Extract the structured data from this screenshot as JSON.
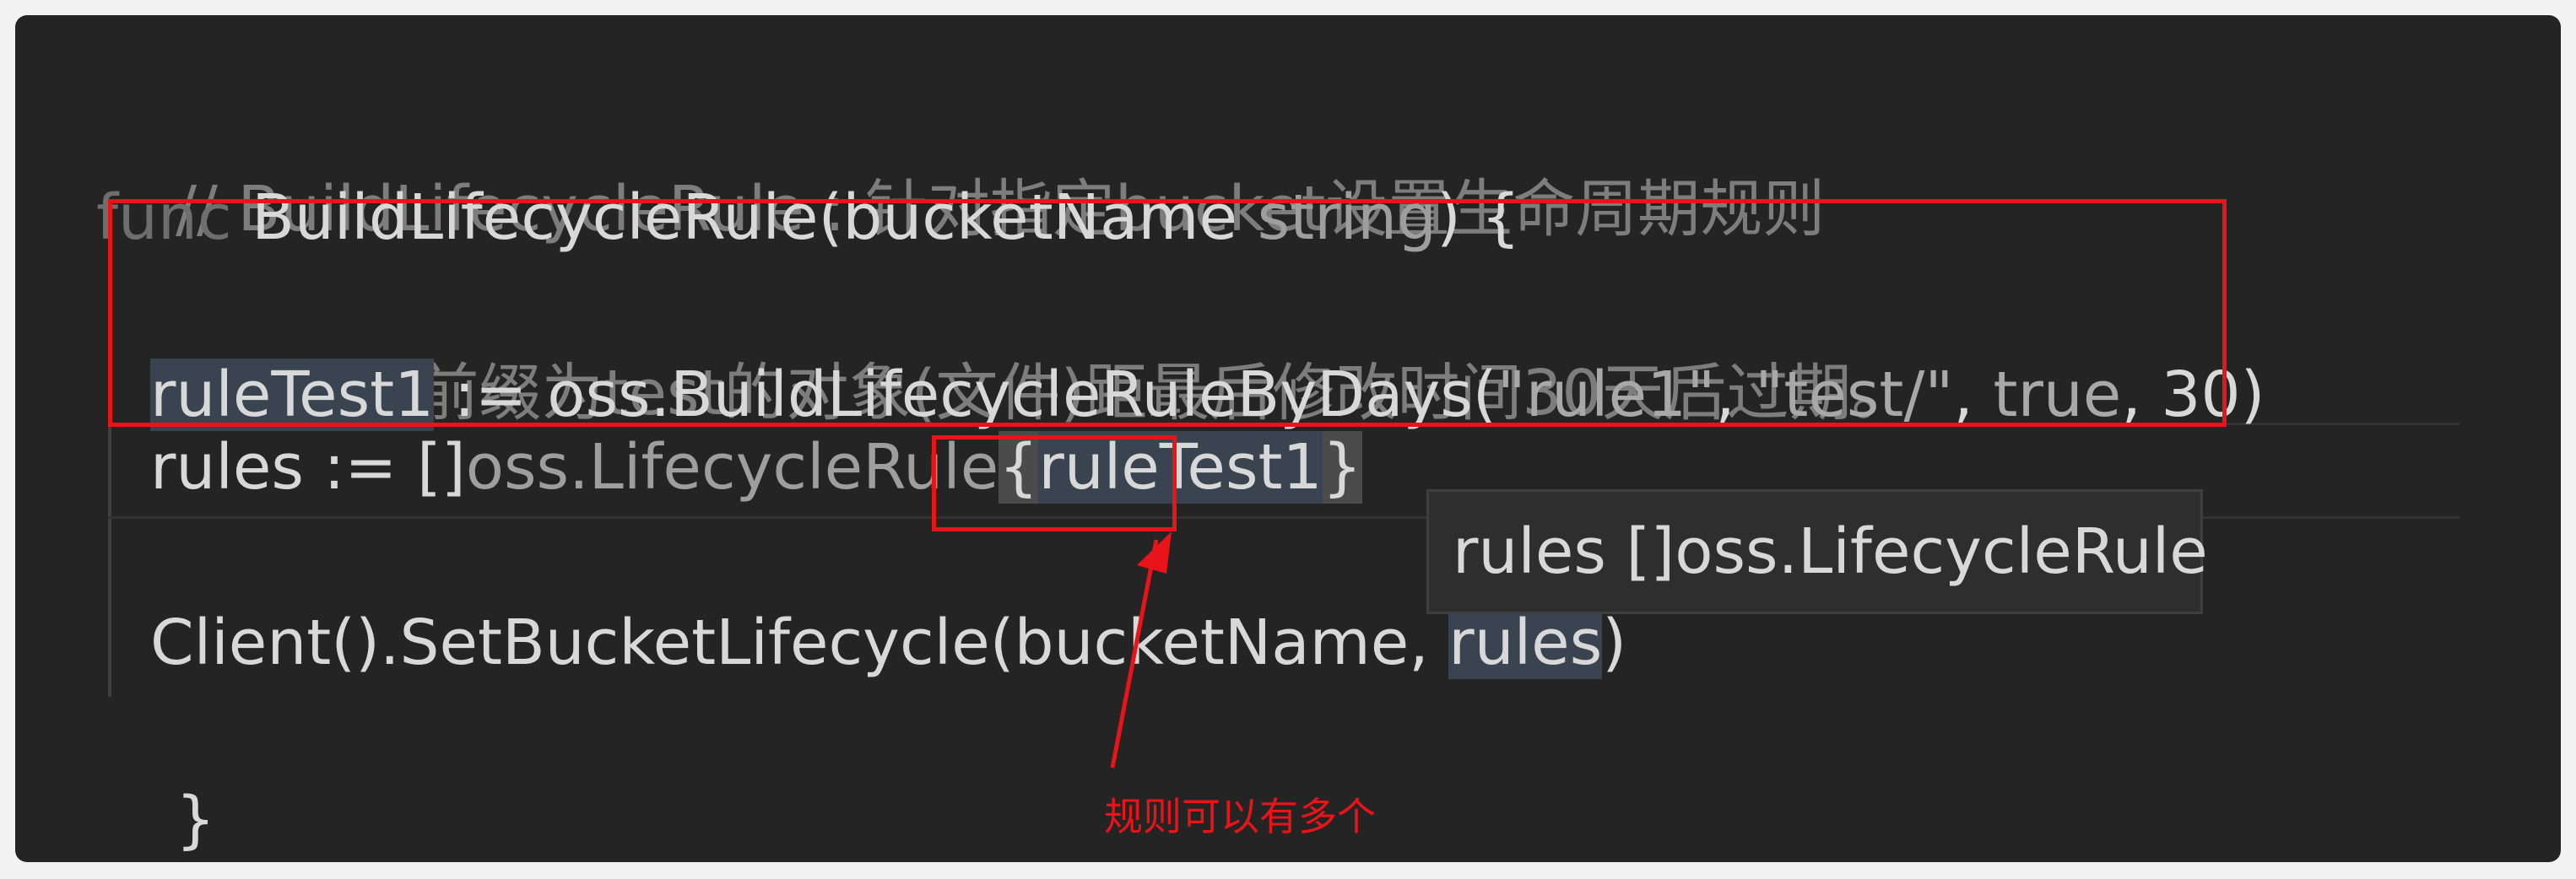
{
  "code": {
    "line1": {
      "comment": "// BuildLifecycleRule : 针对指定bucket设置生命周期规则"
    },
    "line2": {
      "kw": "func",
      "name": " BuildLifecycleRule(",
      "param": "bucketName",
      "type": " string",
      "rest": ") {"
    },
    "line3": {
      "comment": "// 表示前缀为test的对象(文件)距最后修改时间30天后过期。"
    },
    "line4": {
      "var": "ruleTest1",
      "op": " := oss.BuildLifecycleRuleByDays(",
      "s1": "\"rule1\"",
      "c1": ", ",
      "s2": "\"test/\"",
      "c2": ", ",
      "b": "true",
      "c3": ", ",
      "n": "30",
      "end": ")"
    },
    "line5": {
      "start": "rules := []",
      "type": "oss.LifecycleRule",
      "open": "{",
      "var": "ruleTest1",
      "close": "}"
    },
    "line7": {
      "start": "Client().SetBucketLifecycle(",
      "arg1": "bucketName",
      "sep": ", ",
      "arg2": "rules",
      "end": ")"
    },
    "line8": {
      "brace": "}"
    }
  },
  "tooltip": {
    "text": "rules []oss.LifecycleRule"
  },
  "annotation": {
    "text": "规则可以有多个"
  },
  "colors": {
    "editor_bg": "#242424",
    "highlight_red": "#e8141a",
    "comment": "#7d7d7d",
    "text": "#d8d8d8"
  }
}
